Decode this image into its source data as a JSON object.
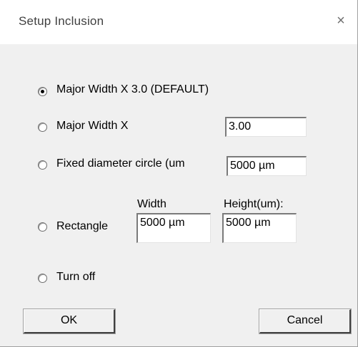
{
  "dialog": {
    "title": "Setup Inclusion",
    "close_glyph": "×"
  },
  "options": [
    {
      "label": "Major Width X 3.0 (DEFAULT)",
      "selected": true
    },
    {
      "label": "Major Width X",
      "selected": false
    },
    {
      "label": "Fixed diameter circle (um",
      "selected": false
    },
    {
      "label": "Rectangle",
      "selected": false
    },
    {
      "label": "Turn off",
      "selected": false
    }
  ],
  "fields": {
    "major_width_value": "3.00",
    "circle_diameter_value": "5000 µm",
    "rect_width_label": "Width",
    "rect_height_label": "Height(um):",
    "rect_width_value": "5000 µm",
    "rect_height_value": "5000 µm"
  },
  "buttons": {
    "ok": "OK",
    "cancel": "Cancel"
  }
}
